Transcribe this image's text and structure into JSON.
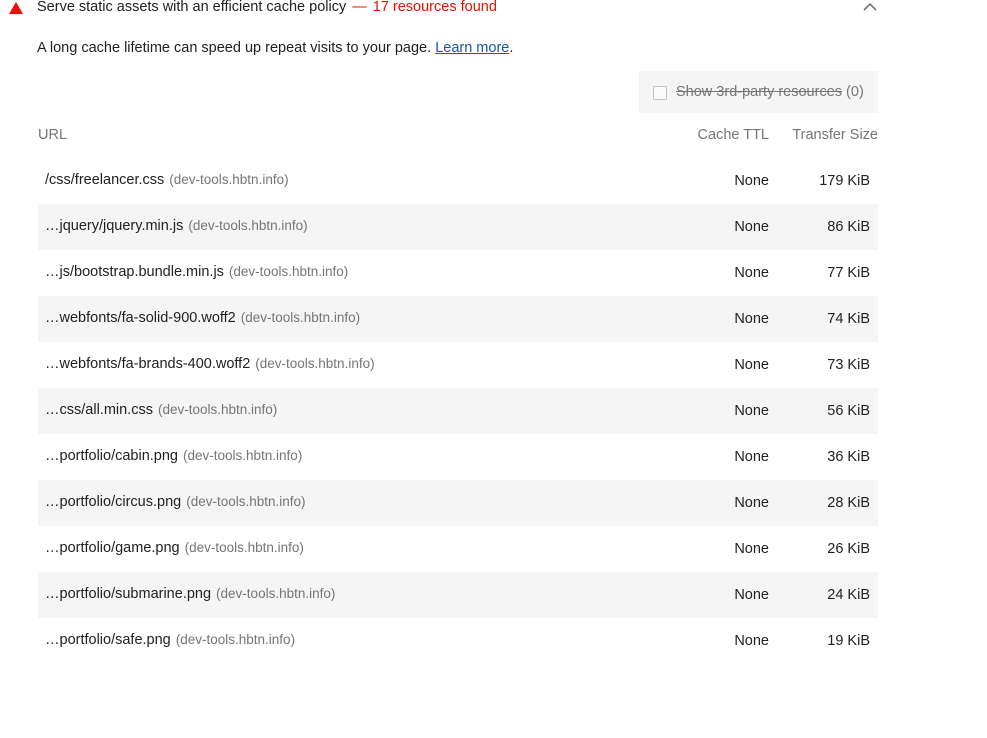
{
  "audit": {
    "title": "Serve static assets with an efficient cache policy",
    "separator": "—",
    "count_text": "17 resources found",
    "status_color": "#eb0f00",
    "description": "A long cache lifetime can speed up repeat visits to your page. ",
    "learn_more": "Learn more",
    "period": "."
  },
  "filter": {
    "label": "Show 3rd-party resources",
    "count": "(0)",
    "checked": false
  },
  "table": {
    "headers": {
      "url": "URL",
      "cache_ttl": "Cache TTL",
      "transfer_size": "Transfer Size"
    },
    "rows": [
      {
        "url": "/css/freelancer.css",
        "host": "(dev-tools.hbtn.info)",
        "ttl": "None",
        "size": "179 KiB"
      },
      {
        "url": "…jquery/jquery.min.js",
        "host": "(dev-tools.hbtn.info)",
        "ttl": "None",
        "size": "86 KiB"
      },
      {
        "url": "…js/bootstrap.bundle.min.js",
        "host": "(dev-tools.hbtn.info)",
        "ttl": "None",
        "size": "77 KiB"
      },
      {
        "url": "…webfonts/fa-solid-900.woff2",
        "host": "(dev-tools.hbtn.info)",
        "ttl": "None",
        "size": "74 KiB"
      },
      {
        "url": "…webfonts/fa-brands-400.woff2",
        "host": "(dev-tools.hbtn.info)",
        "ttl": "None",
        "size": "73 KiB"
      },
      {
        "url": "…css/all.min.css",
        "host": "(dev-tools.hbtn.info)",
        "ttl": "None",
        "size": "56 KiB"
      },
      {
        "url": "…portfolio/cabin.png",
        "host": "(dev-tools.hbtn.info)",
        "ttl": "None",
        "size": "36 KiB"
      },
      {
        "url": "…portfolio/circus.png",
        "host": "(dev-tools.hbtn.info)",
        "ttl": "None",
        "size": "28 KiB"
      },
      {
        "url": "…portfolio/game.png",
        "host": "(dev-tools.hbtn.info)",
        "ttl": "None",
        "size": "26 KiB"
      },
      {
        "url": "…portfolio/submarine.png",
        "host": "(dev-tools.hbtn.info)",
        "ttl": "None",
        "size": "24 KiB"
      },
      {
        "url": "…portfolio/safe.png",
        "host": "(dev-tools.hbtn.info)",
        "ttl": "None",
        "size": "19 KiB"
      }
    ]
  }
}
